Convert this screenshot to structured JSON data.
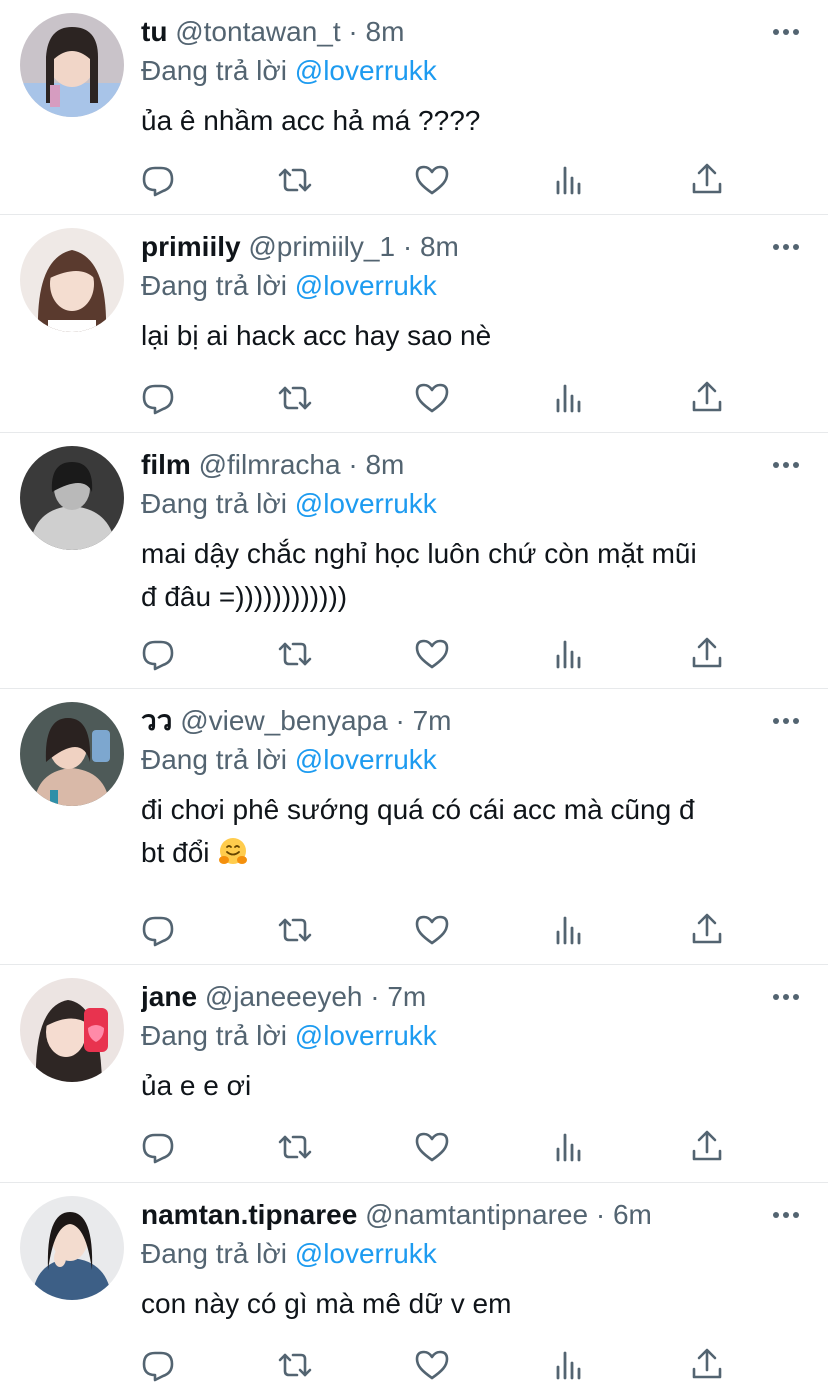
{
  "reply_prefix": "Đang trả lời",
  "colors": {
    "text": "#0f1419",
    "secondary": "#536471",
    "link": "#1d9bf0",
    "divider": "#e7e9eb"
  },
  "action_icons": [
    "reply-icon",
    "retweet-icon",
    "like-icon",
    "views-icon",
    "share-icon"
  ],
  "tweets": [
    {
      "name": "tu",
      "handle": "@tontawan_t",
      "separator": "·",
      "time": "8m",
      "mention": "@loverrukk",
      "lines": [
        "ủa ê nhầm acc hả má ????"
      ]
    },
    {
      "name": "primiily",
      "handle": "@primiily_1",
      "separator": "·",
      "time": "8m",
      "mention": "@loverrukk",
      "lines": [
        "lại bị ai hack acc hay sao nè"
      ]
    },
    {
      "name": "film",
      "handle": "@filmracha",
      "separator": "·",
      "time": "8m",
      "mention": "@loverrukk",
      "lines": [
        "mai dậy chắc nghỉ học luôn chứ còn mặt mũi",
        "đ đâu =))))))))))))"
      ]
    },
    {
      "name": "วว",
      "handle": "@view_benyapa",
      "separator": "·",
      "time": "7m",
      "mention": "@loverrukk",
      "lines": [
        "đi chơi phê sướng quá có cái acc mà cũng đ",
        "bt đổi"
      ],
      "emoji": "hugging-face-emoji"
    },
    {
      "name": "jane",
      "handle": "@janeeeyeh",
      "separator": "·",
      "time": "7m",
      "mention": "@loverrukk",
      "lines": [
        "ủa e e ơi"
      ]
    },
    {
      "name": "namtan.tipnaree",
      "handle": "@namtantipnaree",
      "separator": "·",
      "time": "6m",
      "mention": "@loverrukk",
      "lines": [
        "con này có gì mà mê dữ v em"
      ]
    }
  ]
}
